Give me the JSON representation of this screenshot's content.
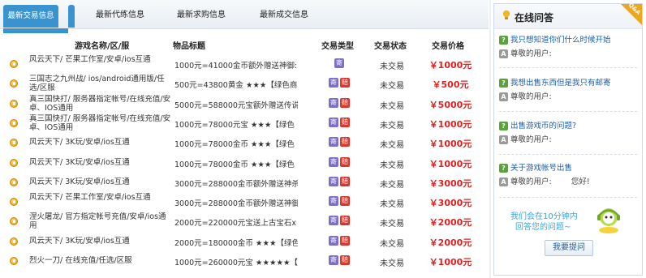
{
  "tabs": [
    {
      "label": "最新交易信息"
    },
    {
      "label": "最新代练信息"
    },
    {
      "label": "最新求购信息"
    },
    {
      "label": "最新成交信息"
    }
  ],
  "table": {
    "headers": [
      "游戏名称/区/服",
      "物品标题",
      "交易类型",
      "交易状态",
      "交易价格"
    ],
    "rows": [
      {
        "name": "风云天下/ 芒果工作室/安卓/ios互通",
        "title": "1000元=41000金币额外赠送神御:",
        "types": [
          "寄"
        ],
        "status": "未交易",
        "price": "￥1000元"
      },
      {
        "name": "三国志之九州战/ ios/android通用版/任选/区服",
        "title": "500元=43800黄金 ★★★【绿色商",
        "types": [
          "寄",
          "赔"
        ],
        "status": "未交易",
        "price": "￥500元"
      },
      {
        "name": "真三国快打/ 服务器指定帐号/在线充值/安卓、IOS通用",
        "title": "5000元=588000元宝额外赠送传说",
        "types": [
          "寄",
          "赔"
        ],
        "status": "未交易",
        "price": "￥5000元"
      },
      {
        "name": "真三国快打/ 服务器指定帐号/在线充值/安卓、IOS通用",
        "title": "1000元=78000元宝 ★★★【绿色",
        "types": [
          "寄",
          "赔"
        ],
        "status": "未交易",
        "price": "￥1000元"
      },
      {
        "name": "风云天下/ 3K玩/安卓/ios互通",
        "title": "1000元=78000金币 ★★★【绿色",
        "types": [
          "寄",
          "赔"
        ],
        "status": "未交易",
        "price": "￥1000元"
      },
      {
        "name": "风云天下/ 3K玩/安卓/ios互通",
        "title": "1000元=78000金币 ★★★【绿色",
        "types": [
          "寄",
          "赔"
        ],
        "status": "未交易",
        "price": "￥1000元"
      },
      {
        "name": "风云天下/ 3K玩/安卓/ios互通",
        "title": "3000元=288000金币额外赠送神杀",
        "types": [
          "寄",
          "赔"
        ],
        "status": "未交易",
        "price": "￥3000元"
      },
      {
        "name": "风云天下/ 芒果工作室/安卓/ios互通",
        "title": "3000元=288000金币额外赠送神御",
        "types": [
          "寄",
          "赔"
        ],
        "status": "未交易",
        "price": "￥3000元"
      },
      {
        "name": "涅火屠龙/ 官方指定帐号充值/安卓/ios通用",
        "title": "2000元=220000元宝送上古宝石x",
        "types": [
          "寄",
          "赔"
        ],
        "status": "未交易",
        "price": "￥2000元"
      },
      {
        "name": "风云天下/ 3K玩/安卓/ios互通",
        "title": "2000元=180000金币 ★★★【绿色",
        "types": [
          "寄",
          "赔"
        ],
        "status": "未交易",
        "price": "￥2000元"
      },
      {
        "name": "烈火一刀/ 在线充值/任选/区服",
        "title": "1000元=260000元宝 ★★★★★【",
        "types": [
          "寄",
          "赔"
        ],
        "status": "未交易",
        "price": "￥1000元"
      }
    ]
  },
  "side": {
    "title": "在线问答",
    "corner": "Q&A",
    "qa": [
      {
        "q": "我只想知道你们什么时候开始",
        "a": "尊敬的用户:"
      },
      {
        "q": "我想出售东西但是我只有邮寄",
        "a": "尊敬的用户:"
      },
      {
        "q": "出售游戏币的问题?",
        "a": "尊敬的用户:"
      },
      {
        "q": "关于游戏帐号出售",
        "a": "尊敬的用户:",
        "a_extra": "您好!"
      }
    ],
    "promo_line1": "我们会在10分钟内",
    "promo_line2": "回答您的问题~",
    "ask_button": "我要提问"
  },
  "colors": {
    "accent": "#3a93cf",
    "price": "#e21f1f",
    "question_link": "#1a5fa8",
    "promo": "#3ba6dd"
  }
}
